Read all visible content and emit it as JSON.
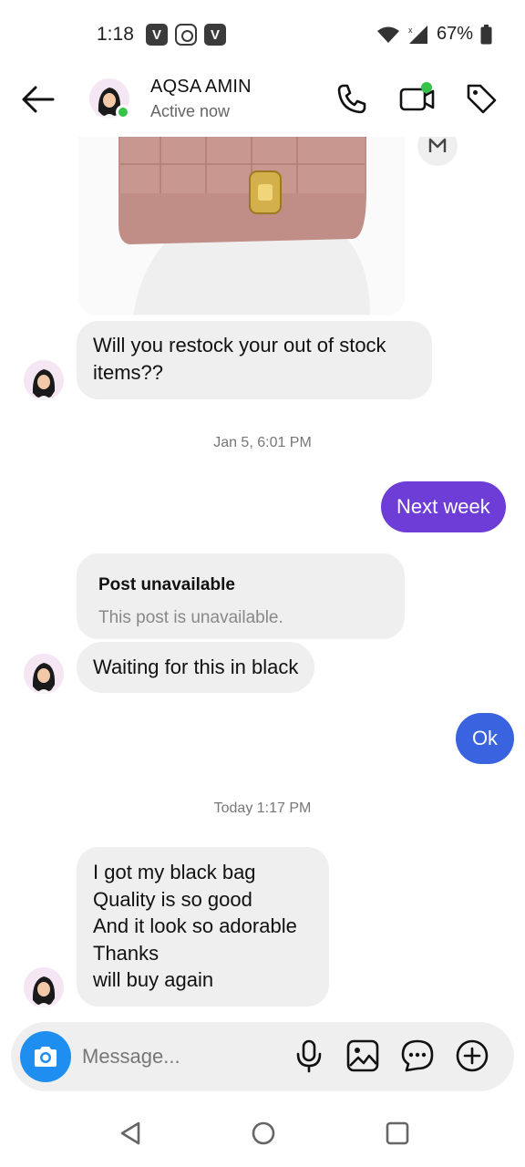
{
  "status_bar": {
    "time": "1:18",
    "app_badges": [
      "V",
      "",
      "V"
    ],
    "battery": "67%"
  },
  "header": {
    "contact_name": "AQSA AMIN",
    "status": "Active now"
  },
  "messages": [
    {
      "text": "Will you restock your out of stock items??"
    },
    {
      "date": "Jan 5, 6:01 PM"
    },
    {
      "text": "Next week"
    },
    {
      "post_title": "Post unavailable",
      "post_subtitle": "This post is unavailable."
    },
    {
      "text": "Waiting for this in black"
    },
    {
      "text": "Ok"
    },
    {
      "date": "Today 1:17 PM"
    },
    {
      "lines": [
        "I got my black bag",
        "Quality is so good",
        "And it look so adorable",
        "Thanks",
        "will buy again"
      ]
    }
  ],
  "composer": {
    "placeholder": "Message..."
  },
  "colors": {
    "outgoing_purple": "#6e3cd6",
    "outgoing_blue": "#3a63e0",
    "incoming_gray": "#efefef",
    "online_green": "#37c24a",
    "camera_blue": "#1e8ef0"
  }
}
